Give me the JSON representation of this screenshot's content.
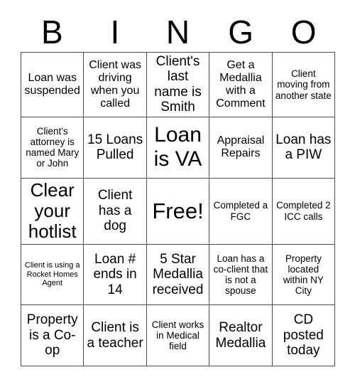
{
  "card": {
    "header_letters": [
      "B",
      "I",
      "N",
      "G",
      "O"
    ],
    "rows": [
      [
        {
          "text": "Loan was suspended",
          "size": "md"
        },
        {
          "text": "Client was driving when you called",
          "size": "md"
        },
        {
          "text": "Client's last name is Smith",
          "size": "lg"
        },
        {
          "text": "Get a Medallia with a Comment",
          "size": "md"
        },
        {
          "text": "Client moving from another state",
          "size": "sm"
        }
      ],
      [
        {
          "text": "Client's attorney is named Mary or John",
          "size": "sm"
        },
        {
          "text": "15 Loans Pulled",
          "size": "lg"
        },
        {
          "text": "Loan is VA",
          "size": "xxl"
        },
        {
          "text": "Appraisal Repairs",
          "size": "md"
        },
        {
          "text": "Loan has a PIW",
          "size": "lg"
        }
      ],
      [
        {
          "text": "Clear your hotlist",
          "size": "xl"
        },
        {
          "text": "Client has a dog",
          "size": "lg"
        },
        {
          "text": "Free!",
          "size": "free"
        },
        {
          "text": "Completed a FGC",
          "size": "sm"
        },
        {
          "text": "Completed 2 ICC calls",
          "size": "sm"
        }
      ],
      [
        {
          "text": "Client is using a Rocket Homes Agent",
          "size": "xs"
        },
        {
          "text": "Loan # ends in 14",
          "size": "lg"
        },
        {
          "text": "5 Star Medallia received",
          "size": "lg"
        },
        {
          "text": "Loan has a co-client that is not a spouse",
          "size": "sm"
        },
        {
          "text": "Property located within NY City",
          "size": "sm"
        }
      ],
      [
        {
          "text": "Property is a Co-op",
          "size": "lg"
        },
        {
          "text": "Client is a teacher",
          "size": "lg"
        },
        {
          "text": "Client works in Medical field",
          "size": "sm"
        },
        {
          "text": "Realtor Medallia",
          "size": "lg"
        },
        {
          "text": "CD posted today",
          "size": "lg"
        }
      ]
    ]
  },
  "style": {
    "border_color": "#4d4d4d",
    "text_color": "#000000",
    "background": "#ffffff"
  }
}
